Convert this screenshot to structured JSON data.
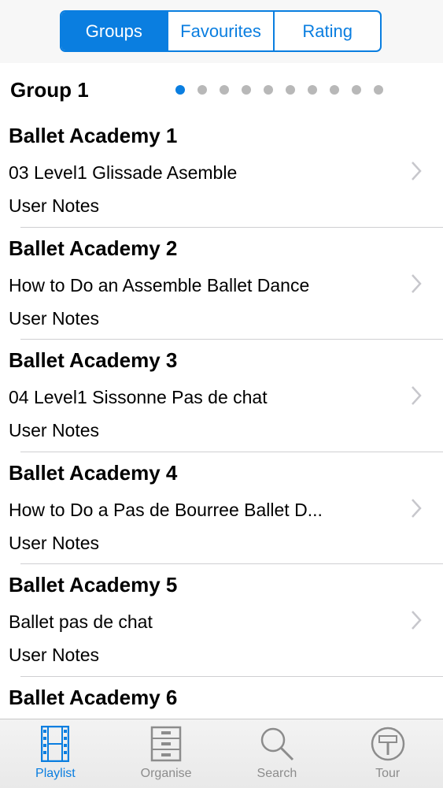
{
  "segments": [
    {
      "label": "Groups",
      "active": true
    },
    {
      "label": "Favourites",
      "active": false
    },
    {
      "label": "Rating",
      "active": false
    }
  ],
  "group": {
    "title": "Group 1",
    "page_count": 10,
    "current_page": 1
  },
  "items": [
    {
      "title": "Ballet Academy 1",
      "subtitle": "03 Level1 Glissade Asemble",
      "notes": "User Notes"
    },
    {
      "title": "Ballet Academy 2",
      "subtitle": "How to Do an Assemble  Ballet Dance",
      "notes": "User Notes"
    },
    {
      "title": "Ballet Academy 3",
      "subtitle": "04 Level1 Sissonne Pas de chat",
      "notes": "User Notes"
    },
    {
      "title": "Ballet Academy 4",
      "subtitle": "How to Do a Pas de Bourree  Ballet D...",
      "notes": "User Notes"
    },
    {
      "title": "Ballet Academy 5",
      "subtitle": "Ballet pas de chat",
      "notes": "User Notes"
    },
    {
      "title": "Ballet Academy 6",
      "subtitle": "",
      "notes": ""
    }
  ],
  "tabs": [
    {
      "label": "Playlist",
      "icon": "film-strip-icon",
      "active": true
    },
    {
      "label": "Organise",
      "icon": "cabinet-icon",
      "active": false
    },
    {
      "label": "Search",
      "icon": "magnifier-icon",
      "active": false
    },
    {
      "label": "Tour",
      "icon": "tour-sign-icon",
      "active": false
    }
  ],
  "colors": {
    "accent": "#0a7ee0",
    "inactive": "#8c8c8c",
    "separator": "#cfcfd2"
  }
}
